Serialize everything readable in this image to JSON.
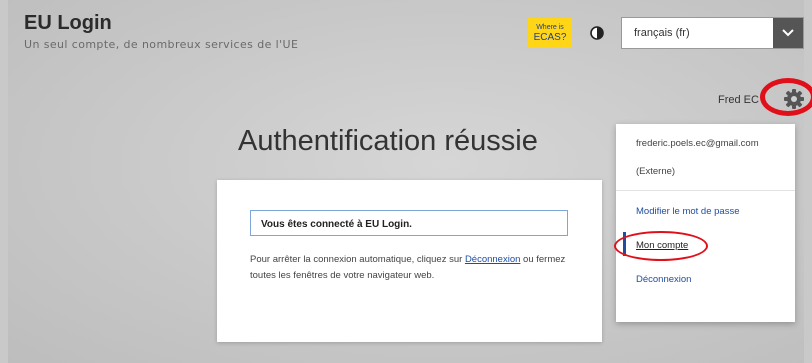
{
  "header": {
    "title": "EU Login",
    "subtitle": "Un seul compte, de nombreux services de l'UE",
    "ecas_button": {
      "line1": "Where is",
      "line2": "ECAS?"
    },
    "language": "français (fr)"
  },
  "user": {
    "display_name": "Fred        EC"
  },
  "main": {
    "heading": "Authentification réussie",
    "notice": "Vous êtes connecté à EU Login.",
    "text_before": "Pour arrêter la connexion automatique, cliquez sur ",
    "logout_link": "Déconnexion",
    "text_after": " ou fermez toutes les fenêtres de votre navigateur web."
  },
  "dropdown": {
    "email": "frederic.poels.ec@gmail.com",
    "type": "(Externe)",
    "change_password": "Modifier le mot de passe",
    "my_account": "Mon compte",
    "logout": "Déconnexion"
  },
  "colors": {
    "accent": "#ffd617",
    "link": "#1f4ea1",
    "annotation": "#e0101a"
  },
  "icons": [
    "contrast-icon",
    "chevron-down-icon",
    "gear-icon"
  ]
}
